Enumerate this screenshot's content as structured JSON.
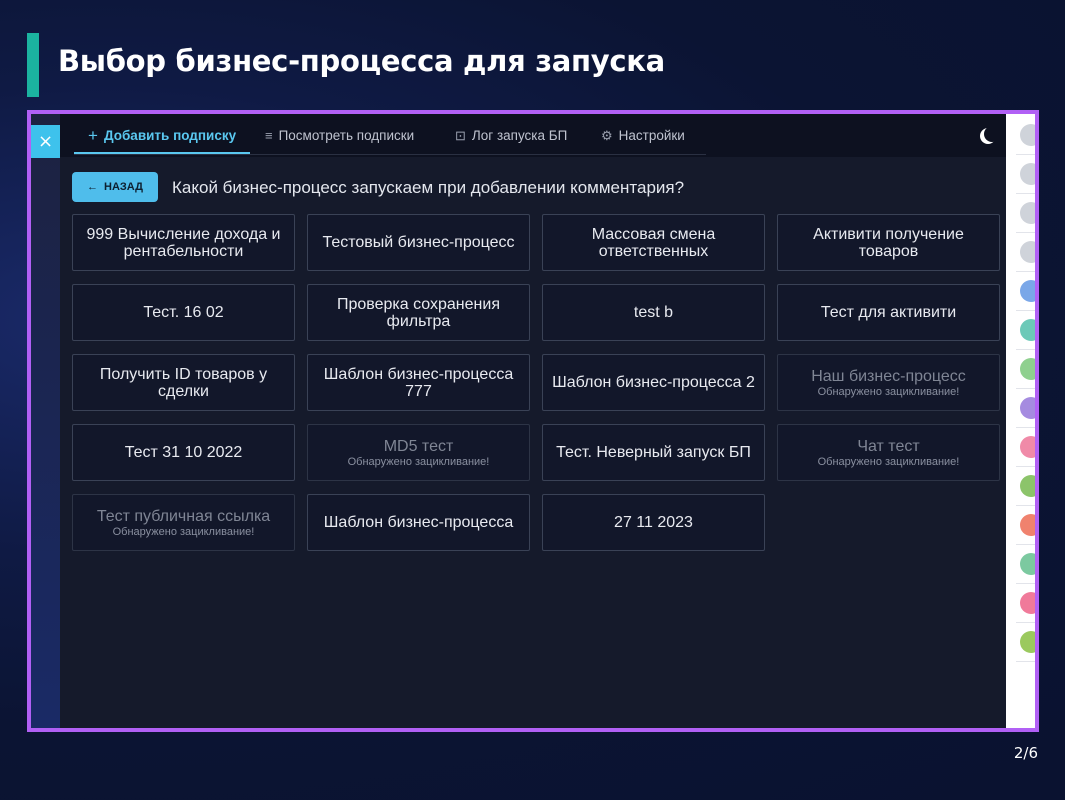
{
  "slide": {
    "title": "Выбор бизнес-процесса для запуска",
    "page": "2/6"
  },
  "colors": {
    "accent_bar": "#1bb3a0",
    "frame_border": "#b160f5",
    "active_tab": "#5ac8f0",
    "back_button": "#4fbdeb"
  },
  "app": {
    "close_icon": "×",
    "tabs": [
      {
        "label": "Добавить подписку",
        "icon": "plus-icon",
        "glyph": "+",
        "active": true
      },
      {
        "label": "Посмотреть подписки",
        "icon": "list-icon",
        "glyph": "≡",
        "active": false
      },
      {
        "label": "Лог запуска БП",
        "icon": "log-icon",
        "glyph": "⊡",
        "active": false
      },
      {
        "label": "Настройки",
        "icon": "sliders-icon",
        "glyph": "⚙",
        "active": false
      }
    ],
    "theme_icon": "moon-icon",
    "back_label": "НАЗАД",
    "back_arrow": "←",
    "question": "Какой бизнес-процесс запускаем при добавлении комментария?",
    "processes": [
      {
        "title": "999 Вычисление дохода и рентабельности",
        "warning": ""
      },
      {
        "title": "Тестовый бизнес-процесс",
        "warning": ""
      },
      {
        "title": "Массовая смена ответственных",
        "warning": ""
      },
      {
        "title": "Активити получение товаров",
        "warning": ""
      },
      {
        "title": "Тест. 16 02",
        "warning": ""
      },
      {
        "title": "Проверка сохранения фильтра",
        "warning": ""
      },
      {
        "title": "test b",
        "warning": ""
      },
      {
        "title": "Тест для активити",
        "warning": ""
      },
      {
        "title": "Получить ID товаров у сделки",
        "warning": ""
      },
      {
        "title": "Шаблон бизнес-процесса 777",
        "warning": ""
      },
      {
        "title": "Шаблон бизнес-процесса 2",
        "warning": ""
      },
      {
        "title": "Наш бизнес-процесс",
        "warning": "Обнаружено зацикливание!"
      },
      {
        "title": "Тест 31 10 2022",
        "warning": ""
      },
      {
        "title": "MD5 тест",
        "warning": "Обнаружено зацикливание!"
      },
      {
        "title": "Тест. Неверный запуск БП",
        "warning": ""
      },
      {
        "title": "Чат тест",
        "warning": "Обнаружено зацикливание!"
      },
      {
        "title": "Тест публичная ссылка",
        "warning": "Обнаружено зацикливание!"
      },
      {
        "title": "Шаблон бизнес-процесса",
        "warning": ""
      },
      {
        "title": "27 11 2023",
        "warning": ""
      }
    ]
  }
}
